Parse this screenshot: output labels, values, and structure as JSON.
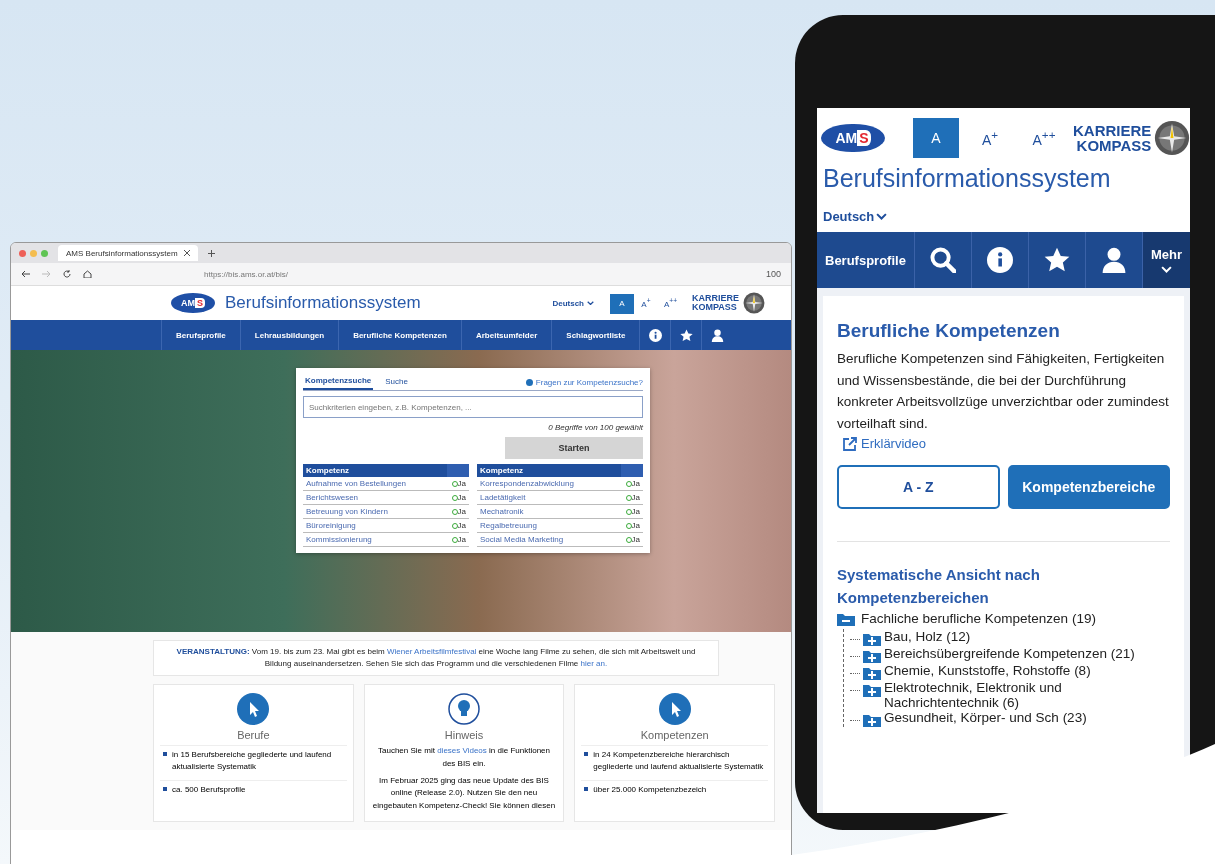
{
  "browser": {
    "tab_title": "AMS Berufsinformationssystem",
    "url": "https://bis.ams.or.at/bis/",
    "zoom": "100"
  },
  "site": {
    "logo": [
      "AM",
      "S"
    ],
    "title": "Berufsinformationssystem",
    "language": "Deutsch",
    "font_sizes": [
      {
        "label": "A",
        "selected": true
      },
      {
        "label": "A$^{+}$",
        "selected": false
      },
      {
        "label": "A$^{++}$",
        "selected": false
      }
    ],
    "kompass": [
      "KARRIERE",
      "KOMPASS"
    ],
    "nav": [
      {
        "kind": "text",
        "label": "Berufsprofile"
      },
      {
        "kind": "text",
        "label": "Lehrausbildungen"
      },
      {
        "kind": "text",
        "label": "Berufliche Kompetenzen"
      },
      {
        "kind": "text",
        "label": "Arbeitsumfelder"
      },
      {
        "kind": "text",
        "label": "Schlagwortliste"
      },
      {
        "kind": "info"
      },
      {
        "kind": "star"
      },
      {
        "kind": "user"
      }
    ]
  },
  "search_panel": {
    "tabs": [
      {
        "label": "Kompetenzsuche",
        "selected": true
      },
      {
        "label": "Suche",
        "selected": false
      }
    ],
    "help": "Fragen zur Kompetenzsuche?",
    "placeholder": "Suchkriterien eingeben, z.B. Kompetenzen, ...",
    "counter": "0 Begriffe von 100 gewählt",
    "button": {
      "label": "Starten",
      "disabled": true
    },
    "tables": [
      {
        "header": "Kompetenz",
        "rows": [
          {
            "name": "Aufnahme von Bestellungen",
            "value": "Ja"
          },
          {
            "name": "Berichtswesen",
            "value": "Ja"
          },
          {
            "name": "Betreuung von Kindern",
            "value": "Ja"
          },
          {
            "name": "Büroreinigung",
            "value": "Ja"
          },
          {
            "name": "Kommissionierung",
            "value": "Ja"
          }
        ]
      },
      {
        "header": "Kompetenz",
        "rows": [
          {
            "name": "Korrespondenzabwicklung",
            "value": "Ja"
          },
          {
            "name": "Ladetätigkeit",
            "value": "Ja"
          },
          {
            "name": "Mechatronik",
            "value": "Ja"
          },
          {
            "name": "Regalbetreuung",
            "value": "Ja"
          },
          {
            "name": "Social Media Marketing",
            "value": "Ja"
          }
        ]
      }
    ]
  },
  "announcement": [
    {
      "kind": "bold",
      "text": "VERANSTALTUNG:"
    },
    {
      "kind": "plain",
      "text": " Vom 19. bis zum 23. Mai gibt es beim "
    },
    {
      "kind": "link",
      "text": "Wiener Arbeitsfilmfestival"
    },
    {
      "kind": "plain",
      "text": " eine Woche lang Filme zu sehen, die sich mit Arbeitswelt und Bildung auseinandersetzen. Sehen Sie sich das Programm und die verschiedenen Filme "
    },
    {
      "kind": "link",
      "text": "hier an."
    }
  ],
  "cards": [
    {
      "title": "Berufe",
      "kind": "bullets",
      "items": [
        "in 15 Berufsbereiche gegliederte und laufend aktualisierte Systematik",
        "ca. 500 Berufsprofile"
      ]
    },
    {
      "title": "Hinweis",
      "kind": "text",
      "paragraphs": [
        [
          {
            "kind": "plain",
            "text": "Tauchen Sie mit "
          },
          {
            "kind": "link",
            "text": "dieses Videos"
          },
          {
            "kind": "plain",
            "text": " in die Funktionen des BIS ein."
          }
        ],
        [
          {
            "kind": "plain",
            "text": "Im Februar 2025 ging das neue Update des BIS online (Release 2.0). Nutzen Sie den neu eingebauten Kompetenz-Check! Sie können diesen"
          }
        ]
      ]
    },
    {
      "title": "Kompetenzen",
      "kind": "bullets",
      "items": [
        "in 24 Kompetenzbereiche hierarchisch gegliederte und laufend aktualisierte Systematik",
        "über 25.000 Kompetenzbezeich"
      ]
    }
  ],
  "phone": {
    "logo": [
      "AM",
      "S"
    ],
    "kompass": [
      "KARRIERE",
      "KOMPASS"
    ],
    "font_sizes": [
      {
        "label": "A",
        "selected": true
      },
      {
        "label": "A$^{+}$",
        "selected": false
      },
      {
        "label": "A$^{++}$",
        "selected": false
      }
    ],
    "title": "Berufsinformationssystem",
    "language": "Deutsch",
    "nav": [
      {
        "kind": "text",
        "label": "Berufsprofile"
      },
      {
        "kind": "search"
      },
      {
        "kind": "info"
      },
      {
        "kind": "star"
      },
      {
        "kind": "user"
      },
      {
        "kind": "more",
        "label": "Mehr"
      }
    ],
    "heading": "Berufliche Kompetenzen",
    "text": "Berufliche Kompetenzen sind Fähigkeiten, Fertigkeiten und Wissensbestände, die bei der Durchführung konkreter Arbeitsvollzüge unverzichtbar oder zumindest vorteilhaft sind.",
    "video_link": "Erklärvideo",
    "views": [
      {
        "label": "A - Z",
        "selected": false
      },
      {
        "label": "Kompetenzbereiche",
        "selected": true
      }
    ],
    "tree_title": "Systematische Ansicht nach Kompetenzbereichen",
    "tree": [
      {
        "label": "Fachliche berufliche Kompetenzen",
        "count": "(19)",
        "expanded": true,
        "children": [
          {
            "label": "Bau, Holz",
            "count": "(12)",
            "expanded": false
          },
          {
            "label": "Bereichsübergreifende Kompetenzen",
            "count": "(21)",
            "expanded": false
          },
          {
            "label": "Chemie, Kunststoffe, Rohstoffe",
            "count": "(8)",
            "expanded": false
          },
          {
            "label": "Elektrotechnik, Elektronik und Nachrichtentechnik",
            "count": "(6)",
            "expanded": false
          },
          {
            "label": "Gesundheit, Körper- und Sch",
            "count": "(23)",
            "expanded": false
          }
        ]
      }
    ]
  }
}
